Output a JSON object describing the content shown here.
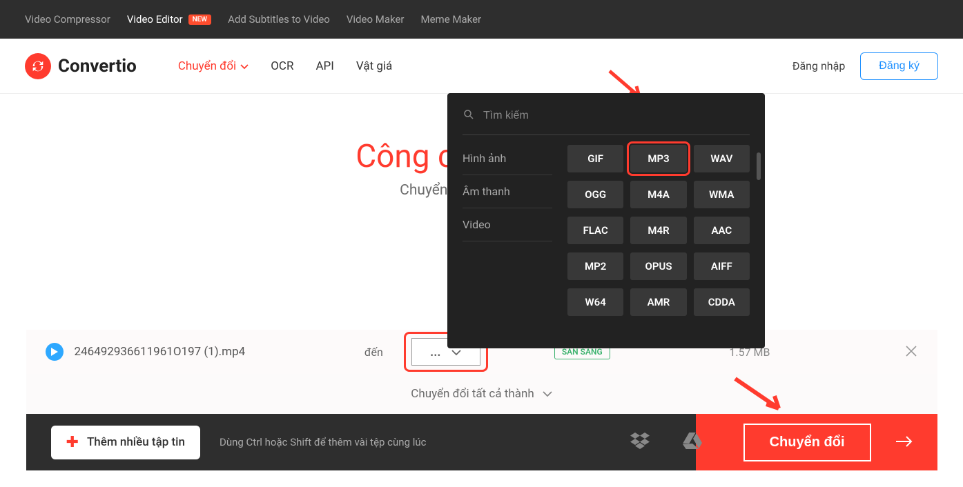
{
  "topbar": {
    "links": [
      "Video Compressor",
      "Video Editor",
      "Add Subtitles to Video",
      "Video Maker",
      "Meme Maker"
    ],
    "new_badge": "NEW",
    "active_index": 1
  },
  "brand": {
    "name": "Convertio"
  },
  "mainnav": {
    "convert": "Chuyển đổi",
    "ocr": "OCR",
    "api": "API",
    "pricing": "Vật giá",
    "login": "Đăng nhập",
    "signup": "Đăng ký"
  },
  "hero": {
    "title": "Công cụ chuyển đ",
    "subtitle": "Chuyển đổi trực tuyến file"
  },
  "dropdown": {
    "search_placeholder": "Tìm kiếm",
    "categories": [
      "Hình ảnh",
      "Âm thanh",
      "Video"
    ],
    "formats": [
      "GIF",
      "MP3",
      "WAV",
      "OGG",
      "M4A",
      "WMA",
      "FLAC",
      "M4R",
      "AAC",
      "MP2",
      "OPUS",
      "AIFF",
      "W64",
      "AMR",
      "CDDA"
    ],
    "highlighted": "MP3"
  },
  "file": {
    "name": "246492936611961O197 (1).mp4",
    "to_label": "đến",
    "selected_format": "...",
    "status": "SẴN SÀNG",
    "size": "1.57 MB"
  },
  "convert_all": "Chuyển đổi tất cả thành",
  "footer": {
    "add_more": "Thêm nhiều tập tin",
    "hint": "Dùng Ctrl hoặc Shift để thêm vài tệp cùng lúc",
    "convert": "Chuyển đổi"
  }
}
